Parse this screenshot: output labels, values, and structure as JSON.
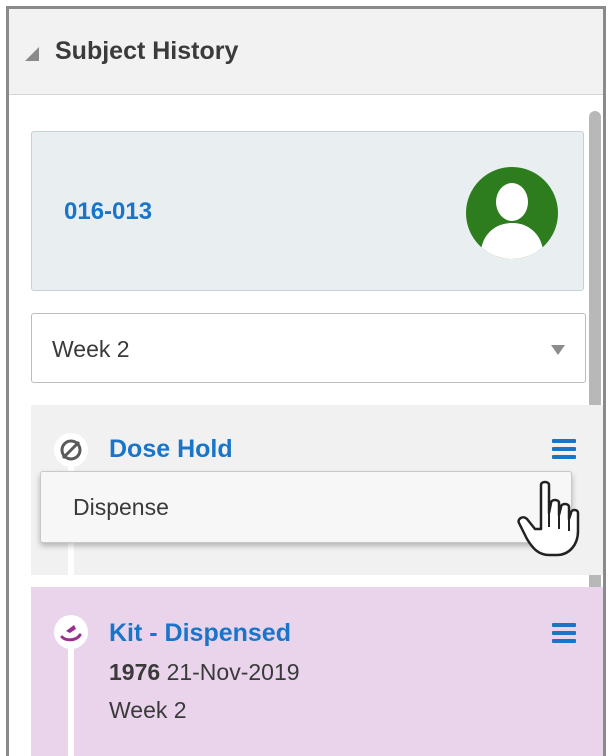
{
  "panel": {
    "title": "Subject History",
    "collapse_icon": "triangle-collapse-icon"
  },
  "subject": {
    "id": "016-013",
    "avatar_icon": "user-avatar-icon",
    "avatar_color": "#2d7d1e"
  },
  "visit_select": {
    "value": "Week 2",
    "arrow_icon": "dropdown-arrow-icon"
  },
  "events": [
    {
      "title": "Dose Hold",
      "icon": "dose-hold-icon",
      "menu_icon": "hamburger-menu-icon",
      "background": "#f1f1f1"
    },
    {
      "title": "Kit - Dispensed",
      "icon": "kit-dispensed-icon",
      "menu_icon": "hamburger-menu-icon",
      "kit_number": "1976",
      "date": "21-Nov-2019",
      "visit": "Week 2",
      "background": "#e9d4ec"
    }
  ],
  "dose_hold_menu": {
    "items": [
      "Dispense"
    ]
  },
  "colors": {
    "link": "#1a75c9",
    "header_bg": "#f2f2f2",
    "card_bg": "#e9eef1"
  }
}
